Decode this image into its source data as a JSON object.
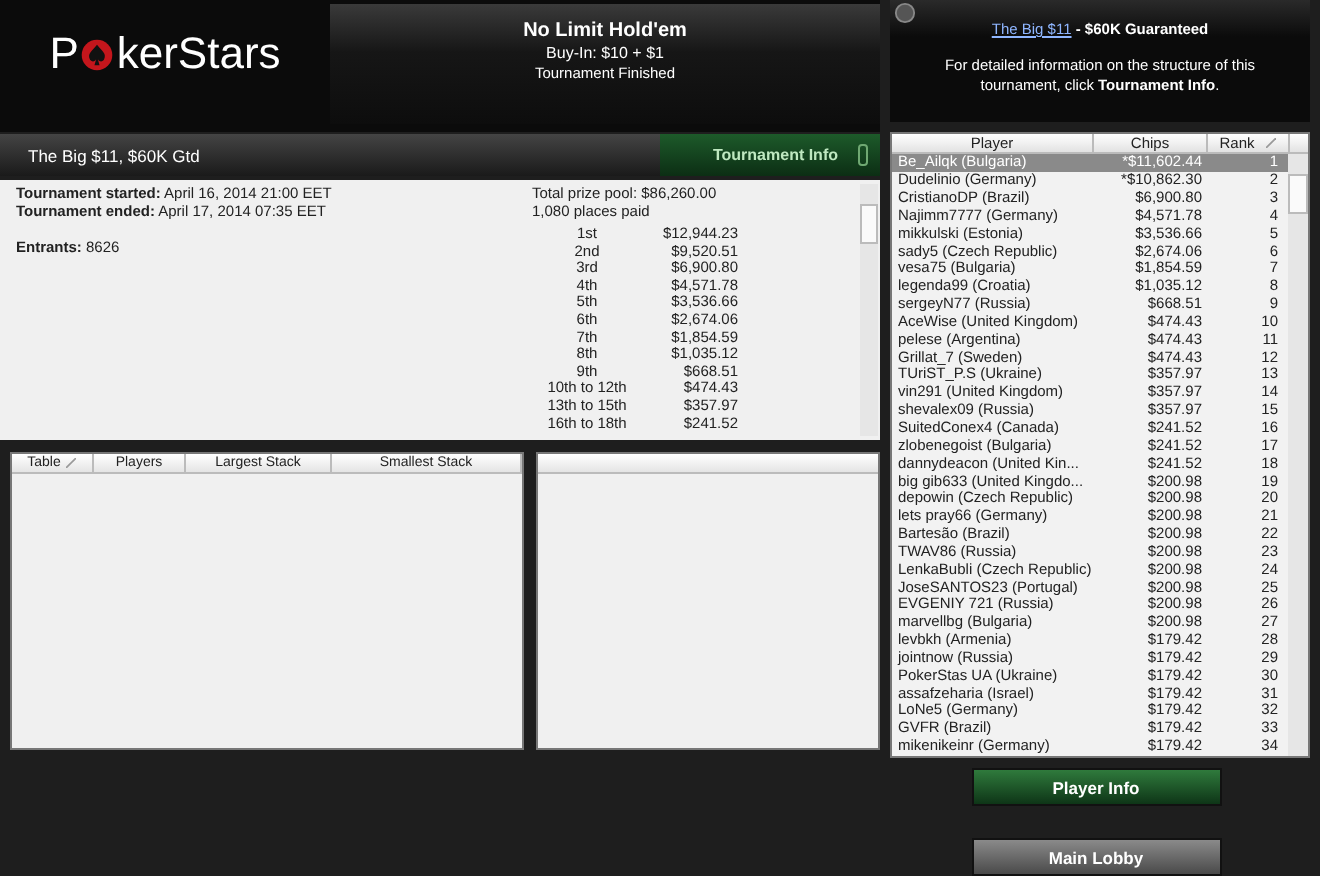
{
  "logo": {
    "parts": [
      "P",
      "kerStars"
    ]
  },
  "header": {
    "game": "No Limit Hold'em",
    "buy_in": "Buy-In: $10 + $1",
    "status": "Tournament Finished"
  },
  "tournament_bar": {
    "name": "The Big $11, $60K Gtd",
    "button": "Tournament Info"
  },
  "info": {
    "started_label": "Tournament started:",
    "started": "April 16, 2014 21:00 EET",
    "ended_label": "Tournament ended:",
    "ended": "April 17, 2014 07:35 EET",
    "entrants_label": "Entrants:",
    "entrants": "8626",
    "prize_pool": "Total prize pool: $86,260.00",
    "places_paid": "1,080 places paid",
    "payouts": [
      {
        "place": "1st",
        "amount": "$12,944.23"
      },
      {
        "place": "2nd",
        "amount": "$9,520.51"
      },
      {
        "place": "3rd",
        "amount": "$6,900.80"
      },
      {
        "place": "4th",
        "amount": "$4,571.78"
      },
      {
        "place": "5th",
        "amount": "$3,536.66"
      },
      {
        "place": "6th",
        "amount": "$2,674.06"
      },
      {
        "place": "7th",
        "amount": "$1,854.59"
      },
      {
        "place": "8th",
        "amount": "$1,035.12"
      },
      {
        "place": "9th",
        "amount": "$668.51"
      },
      {
        "place": "10th to 12th",
        "amount": "$474.43"
      },
      {
        "place": "13th to 15th",
        "amount": "$357.97"
      },
      {
        "place": "16th to 18th",
        "amount": "$241.52"
      }
    ]
  },
  "tables": {
    "columns": [
      {
        "label": "Table",
        "sorted": true
      },
      {
        "label": "Players",
        "sorted": false
      },
      {
        "label": "Largest Stack",
        "sorted": false
      },
      {
        "label": "Smallest Stack",
        "sorted": false
      }
    ]
  },
  "description": {
    "link": "The Big $11",
    "title": " - $60K Guaranteed",
    "text": "For detailed information on the structure of this tournament, click **Tournament Info**."
  },
  "players": {
    "columns": [
      {
        "label": "Player",
        "sorted": false
      },
      {
        "label": "Chips",
        "sorted": false
      },
      {
        "label": "Rank",
        "sorted": true
      }
    ],
    "rows": [
      {
        "player": "Be_Ailqk (Bulgaria)",
        "chips": "*$11,602.44",
        "rank": "1",
        "selected": true
      },
      {
        "player": "Dudelinio (Germany)",
        "chips": "*$10,862.30",
        "rank": "2",
        "selected": false
      },
      {
        "player": "CristianoDP (Brazil)",
        "chips": "$6,900.80",
        "rank": "3",
        "selected": false
      },
      {
        "player": "Najimm7777 (Germany)",
        "chips": "$4,571.78",
        "rank": "4",
        "selected": false
      },
      {
        "player": "mikkulski (Estonia)",
        "chips": "$3,536.66",
        "rank": "5",
        "selected": false
      },
      {
        "player": "sady5 (Czech Republic)",
        "chips": "$2,674.06",
        "rank": "6",
        "selected": false
      },
      {
        "player": "vesa75 (Bulgaria)",
        "chips": "$1,854.59",
        "rank": "7",
        "selected": false
      },
      {
        "player": "legenda99 (Croatia)",
        "chips": "$1,035.12",
        "rank": "8",
        "selected": false
      },
      {
        "player": "sergeyN77 (Russia)",
        "chips": "$668.51",
        "rank": "9",
        "selected": false
      },
      {
        "player": "AceWise (United Kingdom)",
        "chips": "$474.43",
        "rank": "10",
        "selected": false
      },
      {
        "player": "pelese (Argentina)",
        "chips": "$474.43",
        "rank": "11",
        "selected": false
      },
      {
        "player": "Grillat_7 (Sweden)",
        "chips": "$474.43",
        "rank": "12",
        "selected": false
      },
      {
        "player": "TUriST_P.S (Ukraine)",
        "chips": "$357.97",
        "rank": "13",
        "selected": false
      },
      {
        "player": "vin291 (United Kingdom)",
        "chips": "$357.97",
        "rank": "14",
        "selected": false
      },
      {
        "player": "shevalex09 (Russia)",
        "chips": "$357.97",
        "rank": "15",
        "selected": false
      },
      {
        "player": "SuitedConex4 (Canada)",
        "chips": "$241.52",
        "rank": "16",
        "selected": false
      },
      {
        "player": "zlobenegoist (Bulgaria)",
        "chips": "$241.52",
        "rank": "17",
        "selected": false
      },
      {
        "player": "dannydeacon (United Kin...",
        "chips": "$241.52",
        "rank": "18",
        "selected": false
      },
      {
        "player": "big gib633 (United Kingdo...",
        "chips": "$200.98",
        "rank": "19",
        "selected": false
      },
      {
        "player": "depowin (Czech Republic)",
        "chips": "$200.98",
        "rank": "20",
        "selected": false
      },
      {
        "player": "lets pray66 (Germany)",
        "chips": "$200.98",
        "rank": "21",
        "selected": false
      },
      {
        "player": "Bartesão (Brazil)",
        "chips": "$200.98",
        "rank": "22",
        "selected": false
      },
      {
        "player": "TWAV86 (Russia)",
        "chips": "$200.98",
        "rank": "23",
        "selected": false
      },
      {
        "player": "LenkaBubli (Czech Republic)",
        "chips": "$200.98",
        "rank": "24",
        "selected": false
      },
      {
        "player": "JoseSANTOS23 (Portugal)",
        "chips": "$200.98",
        "rank": "25",
        "selected": false
      },
      {
        "player": "EVGENIY 721 (Russia)",
        "chips": "$200.98",
        "rank": "26",
        "selected": false
      },
      {
        "player": "marvellbg (Bulgaria)",
        "chips": "$200.98",
        "rank": "27",
        "selected": false
      },
      {
        "player": "levbkh (Armenia)",
        "chips": "$179.42",
        "rank": "28",
        "selected": false
      },
      {
        "player": "jointnow (Russia)",
        "chips": "$179.42",
        "rank": "29",
        "selected": false
      },
      {
        "player": "PokerStas UA (Ukraine)",
        "chips": "$179.42",
        "rank": "30",
        "selected": false
      },
      {
        "player": "assafzeharia (Israel)",
        "chips": "$179.42",
        "rank": "31",
        "selected": false
      },
      {
        "player": "LoNe5 (Germany)",
        "chips": "$179.42",
        "rank": "32",
        "selected": false
      },
      {
        "player": "GVFR (Brazil)",
        "chips": "$179.42",
        "rank": "33",
        "selected": false
      },
      {
        "player": "mikenikeinr (Germany)",
        "chips": "$179.42",
        "rank": "34",
        "selected": false
      }
    ]
  },
  "buttons": [
    {
      "label": "Player Info",
      "kind": "primary"
    },
    {
      "label": "Main Lobby",
      "kind": "secondary"
    }
  ]
}
